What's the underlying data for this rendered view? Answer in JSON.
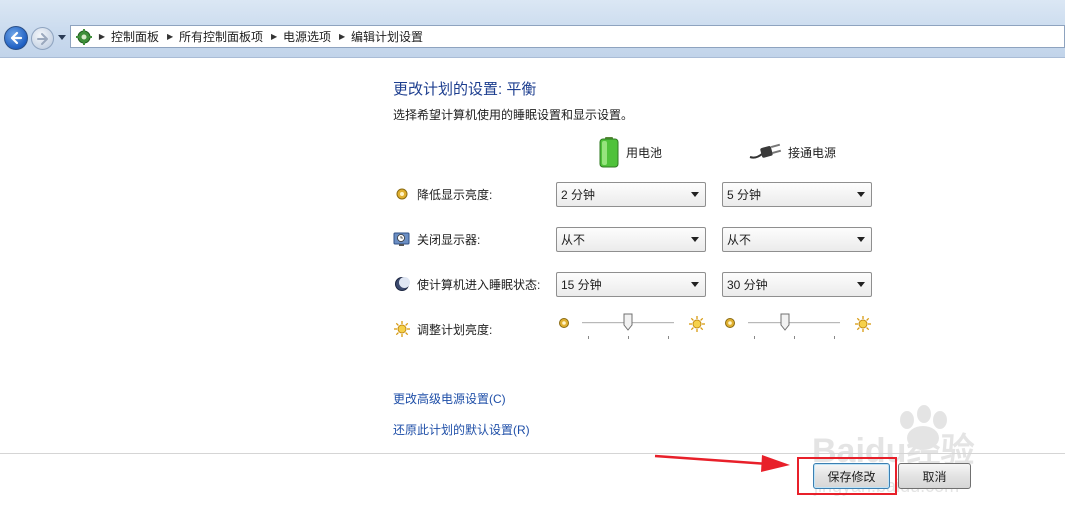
{
  "breadcrumb": {
    "items": [
      "控制面板",
      "所有控制面板项",
      "电源选项",
      "编辑计划设置"
    ]
  },
  "page": {
    "title": "更改计划的设置: 平衡",
    "subtitle": "选择希望计算机使用的睡眠设置和显示设置。"
  },
  "columns": {
    "battery": "用电池",
    "plugged_in": "接通电源"
  },
  "settings": [
    {
      "label": "降低显示亮度:",
      "battery": "2 分钟",
      "plugged_in": "5 分钟"
    },
    {
      "label": "关闭显示器:",
      "battery": "从不",
      "plugged_in": "从不"
    },
    {
      "label": "使计算机进入睡眠状态:",
      "battery": "15 分钟",
      "plugged_in": "30 分钟"
    }
  ],
  "brightness": {
    "label": "调整计划亮度:",
    "battery_level": 0.5,
    "plugged_in_level": 0.4
  },
  "links": {
    "advanced": "更改高级电源设置(C)",
    "restore": "还原此计划的默认设置(R)"
  },
  "buttons": {
    "save": "保存修改",
    "cancel": "取消"
  },
  "watermark": {
    "text": "Baidu经验",
    "sub": "jingyan.baidu.com"
  },
  "colors": {
    "link": "#1f4fa8",
    "title": "#1d3e8f",
    "annotation_red": "#e8202a"
  }
}
